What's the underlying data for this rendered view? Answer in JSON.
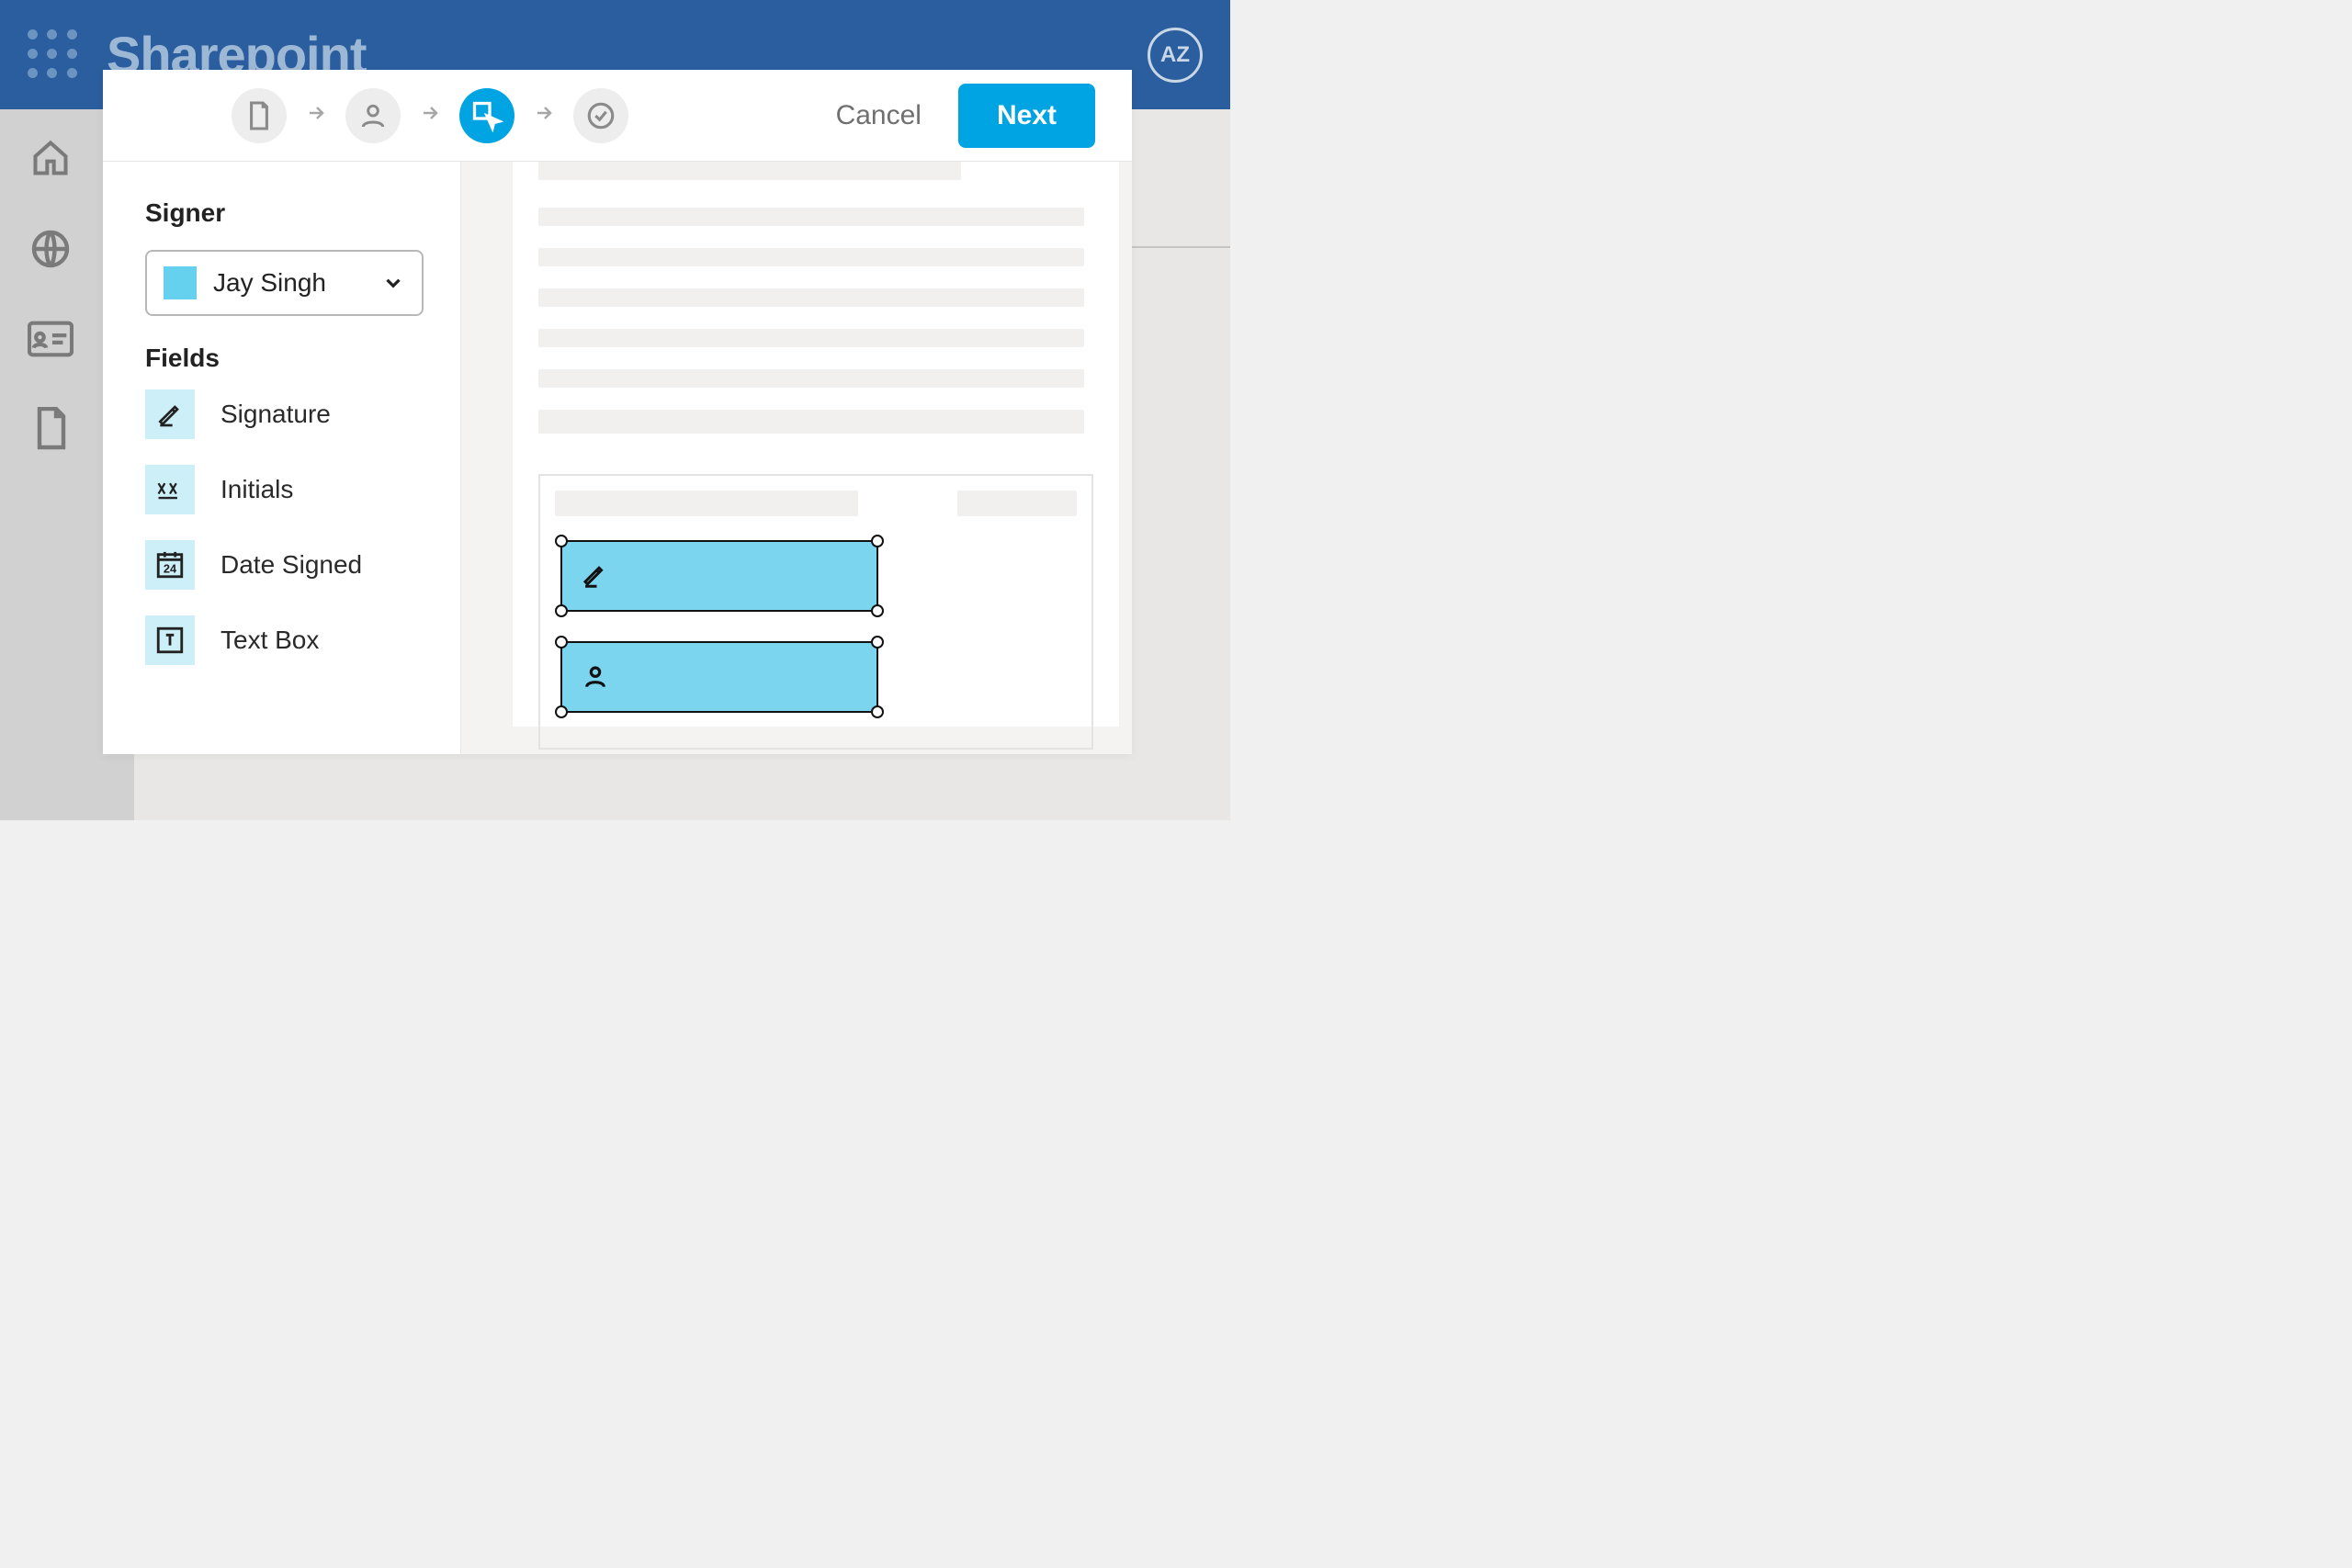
{
  "topbar": {
    "brand": "Sharepoint",
    "avatar_initials": "AZ"
  },
  "modal": {
    "cancel_label": "Cancel",
    "next_label": "Next",
    "signer_heading": "Signer",
    "fields_heading": "Fields",
    "signer_selected": "Jay Singh",
    "signer_color": "#66d0ef",
    "fields": [
      {
        "id": "signature",
        "label": "Signature"
      },
      {
        "id": "initials",
        "label": "Initials"
      },
      {
        "id": "date-signed",
        "label": "Date Signed"
      },
      {
        "id": "text-box",
        "label": "Text Box"
      }
    ],
    "steps": [
      {
        "id": "document",
        "active": false
      },
      {
        "id": "people",
        "active": false
      },
      {
        "id": "place-fields",
        "active": true
      },
      {
        "id": "review",
        "active": false
      }
    ]
  }
}
